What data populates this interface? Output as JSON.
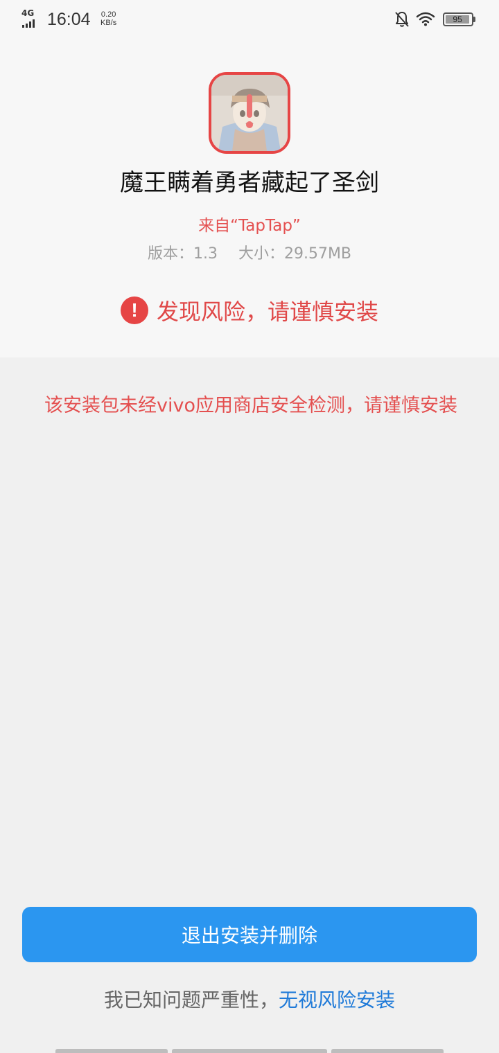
{
  "status_bar": {
    "network": "4G",
    "time": "16:04",
    "speed_value": "0.20",
    "speed_unit": "KB/s",
    "battery": "95",
    "battery_level": 0.95,
    "icons": [
      "signal-icon",
      "bell-off-icon",
      "wifi-icon",
      "battery-icon"
    ]
  },
  "app": {
    "name": "魔王瞒着勇者藏起了圣剑",
    "source": "来自“TapTap”",
    "version_label": "版本：1.3",
    "size_label": "大小：29.57MB"
  },
  "risk": {
    "title": "发现风险，请谨慎安装",
    "description": "该安装包未经vivo应用商店安全检测，请谨慎安装"
  },
  "actions": {
    "exit_delete": "退出安装并删除",
    "ignore_prefix": "我已知问题严重性，",
    "ignore_link": "无视风险安装"
  },
  "colors": {
    "danger": "#e64545",
    "primary": "#2b96f0",
    "link": "#1f7ad8"
  }
}
